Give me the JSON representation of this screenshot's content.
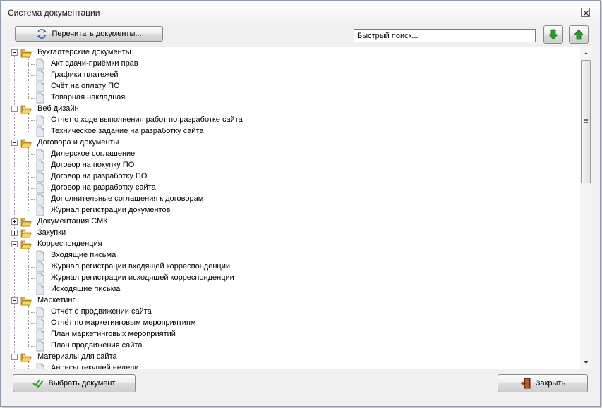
{
  "window": {
    "title": "Система документации"
  },
  "toolbar": {
    "reload_label": "Перечитать документы...",
    "search_value": "Быстрый поиск...",
    "search_placeholder": "Быстрый поиск..."
  },
  "footer": {
    "select_label": "Выбрать документ",
    "close_label": "Закрыть"
  },
  "colors": {
    "folder": "#f2c84b",
    "arrow_green": "#2e9a2e",
    "check_green": "#3a9b25"
  },
  "tree": [
    {
      "label": "Бухгалтерские документы",
      "expanded": true,
      "children": [
        "Акт сдачи-приёмки прав",
        "Графики платежей",
        "Счёт на оплату ПО",
        "Товарная накладная"
      ]
    },
    {
      "label": "Веб дизайн",
      "expanded": true,
      "children": [
        "Отчет о ходе выполнения работ по разработке сайта",
        "Техническое задание на разработку сайта"
      ]
    },
    {
      "label": "Договора и документы",
      "expanded": true,
      "children": [
        "Дилерское соглашение",
        "Договор на покупку ПО",
        "Договор на разработку ПО",
        "Договор на разработку сайта",
        "Дополнительные соглашения к договорам",
        "Журнал регистрации документов"
      ]
    },
    {
      "label": "Документация СМК",
      "expanded": false,
      "children": []
    },
    {
      "label": "Закупки",
      "expanded": false,
      "children": []
    },
    {
      "label": "Корреспонденция",
      "expanded": true,
      "children": [
        "Входящие письма",
        "Журнал регистрации входящей корреспонденции",
        "Журнал регистрации исходящей корреспонденции",
        "Исходящие письма"
      ]
    },
    {
      "label": "Маркетинг",
      "expanded": true,
      "children": [
        "Отчёт о продвижении сайта",
        "Отчёт по маркетинговым мероприятиям",
        "План маркетинговых мероприятий",
        "План продвижения сайта"
      ]
    },
    {
      "label": "Материалы для сайта",
      "expanded": true,
      "children": [
        "Анонсы текущей недели"
      ]
    }
  ]
}
